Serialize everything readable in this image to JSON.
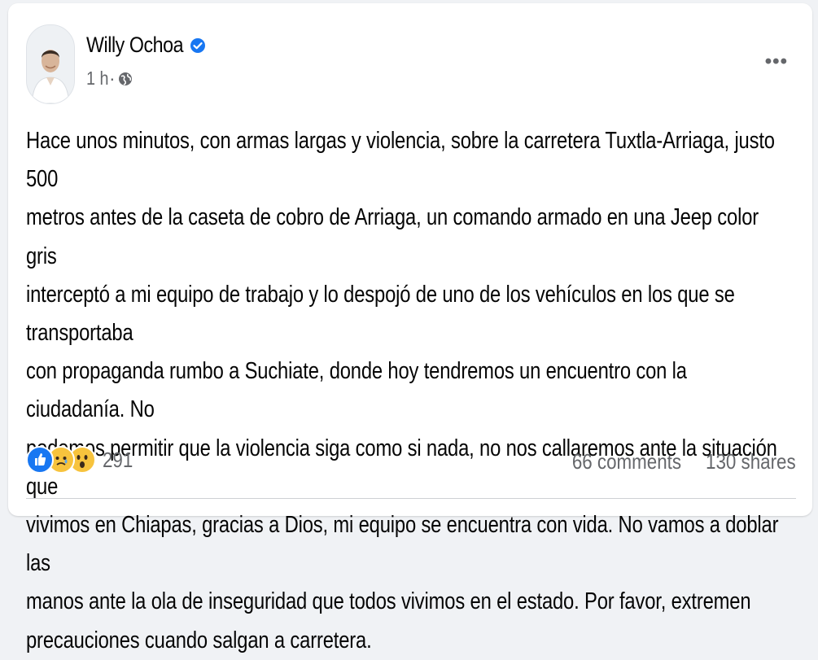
{
  "post": {
    "author": "Willy Ochoa",
    "verified_icon": "verified-badge-icon",
    "time": "1 h",
    "separator": "·",
    "audience_icon": "globe-icon",
    "more_label": "•••",
    "text": "Hace unos minutos, con armas largas y violencia, sobre la carretera Tuxtla-Arriaga, justo 500 metros antes de la caseta de cobro de Arriaga, un comando armado en una Jeep color gris interceptó a mi equipo de trabajo y lo despojó de uno de los vehículos en los que se transportaba con propaganda rumbo a Suchiate, donde hoy tendremos un encuentro con la ciudadanía. No podemos permitir que la violencia siga como si nada, no nos callaremos ante la situación que vivimos en Chiapas, gracias a Dios, mi equipo se encuentra con vida. No vamos a doblar las manos ante la ola de inseguridad que todos vivimos en el estado. Por favor, extremen precauciones cuando salgan a carretera.",
    "lines": [
      "Hace unos minutos, con armas largas y violencia, sobre la carretera Tuxtla-Arriaga, justo 500",
      "metros antes de la caseta de cobro de Arriaga, un comando armado en una Jeep color gris",
      "interceptó a mi equipo de trabajo y lo despojó de uno de los vehículos en los que se transportaba",
      "con propaganda rumbo a Suchiate, donde hoy tendremos un encuentro con la ciudadanía. No",
      "podemos permitir que la violencia siga como si nada, no nos callaremos ante la situación que",
      "vivimos en Chiapas, gracias a Dios, mi equipo se encuentra con vida. No vamos a doblar las",
      "manos ante la ola de inseguridad que todos vivimos en el estado. Por favor, extremen",
      "precauciones cuando salgan a carretera."
    ]
  },
  "reactions": {
    "icons": [
      "like-icon",
      "sad-icon",
      "wow-icon"
    ],
    "count": "291"
  },
  "stats": {
    "comments": "66 comments",
    "shares": "130 shares"
  },
  "colors": {
    "verified": "#1877f2",
    "like": "#1877f2",
    "emoji": "#f7c33d",
    "secondary_text": "#65676b",
    "primary_text": "#050505"
  }
}
